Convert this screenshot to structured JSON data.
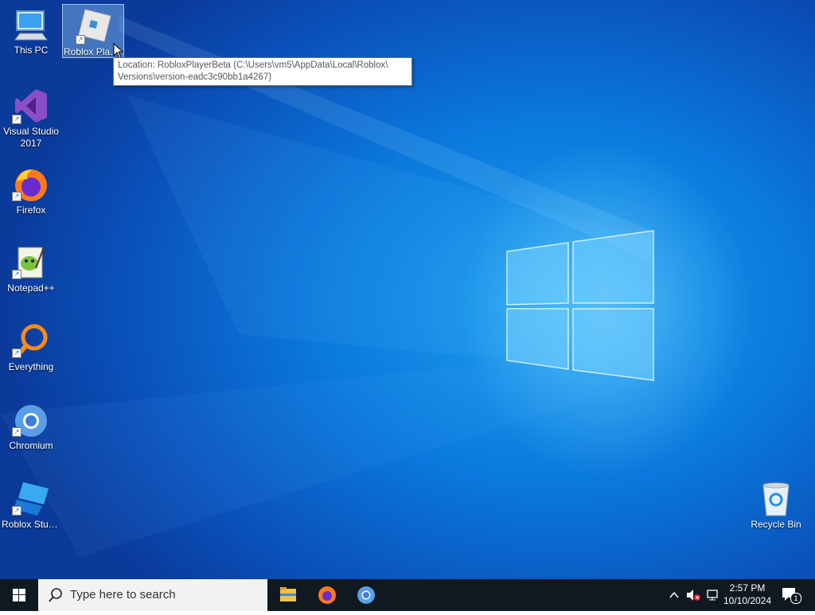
{
  "desktop": {
    "icons": [
      {
        "label": "This PC",
        "icon": "this-pc-icon"
      },
      {
        "label": "Roblox Player",
        "icon": "roblox-player-icon",
        "selected": true
      },
      {
        "label": "Visual Studio 2017",
        "icon": "visual-studio-icon"
      },
      {
        "label": "Firefox",
        "icon": "firefox-icon"
      },
      {
        "label": "Notepad++",
        "icon": "notepadpp-icon"
      },
      {
        "label": "Everything",
        "icon": "everything-icon"
      },
      {
        "label": "Chromium",
        "icon": "chromium-icon"
      },
      {
        "label": "Roblox Studio",
        "icon": "roblox-studio-icon"
      },
      {
        "label": "Recycle Bin",
        "icon": "recycle-bin-icon"
      }
    ],
    "tooltip": {
      "line1": "Location: RobloxPlayerBeta (C:\\Users\\vm5\\AppData\\Local\\Roblox\\",
      "line2": "Versions\\version-eadc3c90bb1a4267)"
    }
  },
  "taskbar": {
    "search_placeholder": "Type here to search",
    "pinned": [
      "file-explorer-icon",
      "firefox-icon",
      "chromium-icon"
    ],
    "clock": {
      "time": "2:57 PM",
      "date": "10/10/2024"
    },
    "notifications_count": "1"
  },
  "colors": {
    "taskbar": "#101820",
    "accent": "#0a78dc"
  }
}
